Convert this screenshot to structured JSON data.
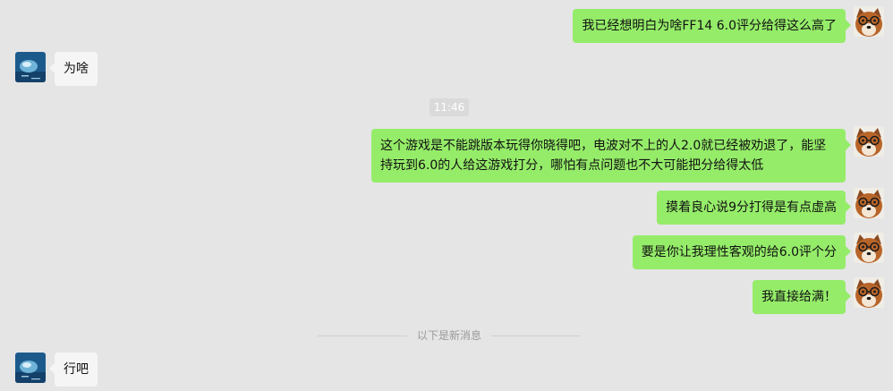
{
  "chat": {
    "timestamp": "11:46",
    "new_messages_divider": "以下是新消息",
    "messages": [
      {
        "sender": "me",
        "text": "我已经想明白为啥FF14 6.0评分给得这么高了"
      },
      {
        "sender": "friend",
        "text": "为啥"
      },
      {
        "sender": "me",
        "text": "这个游戏是不能跳版本玩得你晓得吧，电波对不上的人2.0就已经被劝退了，能坚持玩到6.0的人给这游戏打分，哪怕有点问题也不大可能把分给得太低"
      },
      {
        "sender": "me",
        "text": "摸着良心说9分打得是有点虚高"
      },
      {
        "sender": "me",
        "text": "要是你让我理性客观的给6.0评个分"
      },
      {
        "sender": "me",
        "text": "我直接给满！"
      },
      {
        "sender": "friend",
        "text": "行吧"
      }
    ]
  },
  "colors": {
    "background": "#e5e5e5",
    "my_bubble": "#95ec69",
    "friend_bubble": "#f5f5f5"
  },
  "icons": {
    "my_avatar": "shiba-dog-with-glasses-avatar",
    "friend_avatar": "blue-ocean-avatar"
  }
}
